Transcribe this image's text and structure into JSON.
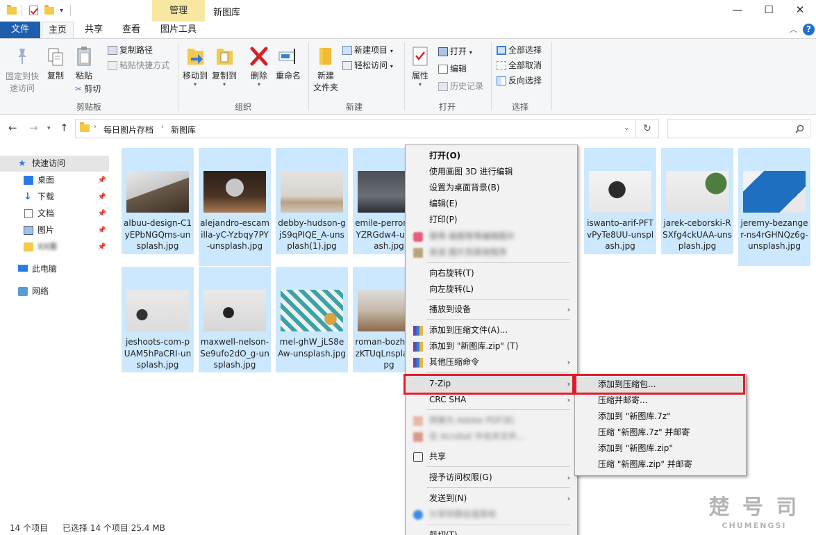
{
  "titlebar": {
    "context_tab": "管理",
    "window_title": "新图库",
    "minimize": "—",
    "maximize": "☐",
    "close": "✕"
  },
  "tabs": [
    "文件",
    "主页",
    "共享",
    "查看",
    "图片工具"
  ],
  "ribbon": {
    "clipboard": {
      "pin_quick_access": "固定到快速访问",
      "copy": "复制",
      "paste": "粘贴",
      "copy_path": "复制路径",
      "paste_shortcut": "粘贴快捷方式",
      "cut": "剪切",
      "group": "剪贴板"
    },
    "organize": {
      "move_to": "移动到",
      "copy_to": "复制到",
      "delete": "删除",
      "rename": "重命名",
      "group": "组织"
    },
    "new": {
      "new_folder_1": "新建",
      "new_folder_2": "文件夹",
      "new_item": "新建项目",
      "easy_access": "轻松访问",
      "group": "新建"
    },
    "open": {
      "properties": "属性",
      "open": "打开",
      "edit": "编辑",
      "history": "历史记录",
      "group": "打开"
    },
    "select": {
      "select_all": "全部选择",
      "select_none": "全部取消",
      "invert": "反向选择",
      "group": "选择"
    }
  },
  "address": {
    "crumbs": [
      "每日图片存档",
      "新图库"
    ],
    "search_placeholder": ""
  },
  "nav": {
    "quick_access": "快速访问",
    "items": [
      "桌面",
      "下载",
      "文档",
      "图片",
      "XX库"
    ],
    "this_pc": "此电脑",
    "network": "网络"
  },
  "files": [
    {
      "name": "albuu-design-C1yEPbNGQms-unsplash.jpg"
    },
    {
      "name": "alejandro-escamilla-yC-Yzbqy7PY-unsplash.jpg"
    },
    {
      "name": "debby-hudson-gjS9qPIQE_A-unsplash(1).jpg"
    },
    {
      "name": "emile-perron-VDYZRGdw4-unsplash.jpg"
    },
    {
      "name": "iswanto-arif-PFTvPyTe8UU-unsplash.jpg"
    },
    {
      "name": "jarek-ceborski-RSXfg4ckUAA-unsplash.jpg"
    },
    {
      "name": "jeremy-bezanger-ns4rGHNQz6g-unsplash.jpg"
    },
    {
      "name": "jeshoots-com-pUAM5hPaCRI-unsplash.jpg"
    },
    {
      "name": "maxwell-nelson-Se9ufo2dO_g-unsplash.jpg"
    },
    {
      "name": "mel-ghW_jLS8eAw-unsplash.jpg"
    },
    {
      "name": "roman-bozhPypjzKTUqLnsplash.jpg"
    }
  ],
  "context_menu": {
    "open": "打开(O)",
    "paint3d": "使用画图 3D 进行编辑",
    "set_bg": "设置为桌面背景(B)",
    "edit": "编辑(E)",
    "print": "打印(P)",
    "blur1": "使用 画图等等编辑图片",
    "blur2": "发送 图片到其他程序",
    "rotate_right": "向右旋转(T)",
    "rotate_left": "向左旋转(L)",
    "cast": "播放到设备",
    "add_archive": "添加到压缩文件(A)...",
    "add_zip": "添加到 \"新图库.zip\" (T)",
    "other_compress": "其他压缩命令",
    "sevenzip": "7-Zip",
    "crc": "CRC SHA",
    "blur3": "转换为 Adobe PDF(B)",
    "blur4": "在 Acrobat 中合并文件...",
    "share": "共享",
    "grant_access": "授予访问权限(G)",
    "send_to": "发送到(N)",
    "blur5": "分享到微信或其他",
    "cut": "剪切(T)"
  },
  "submenu": {
    "add_to_archive": "添加到压缩包...",
    "compress_email": "压缩并邮寄...",
    "add_7z": "添加到 \"新图库.7z\"",
    "compress_7z_email": "压缩 \"新图库.7z\" 并邮寄",
    "add_zip": "添加到 \"新图库.zip\"",
    "compress_zip_email": "压缩 \"新图库.zip\" 并邮寄"
  },
  "status": {
    "count": "14 个项目",
    "selected": "已选择 14 个项目  25.4 MB"
  },
  "watermark": {
    "line1": "楚 号 司",
    "line2": "CHUMENGSI"
  },
  "colors": {
    "selection": "#cce8ff",
    "file_tab": "#1e5fad",
    "highlight": "#e01b2b",
    "context_tab": "#f7e7a0"
  }
}
